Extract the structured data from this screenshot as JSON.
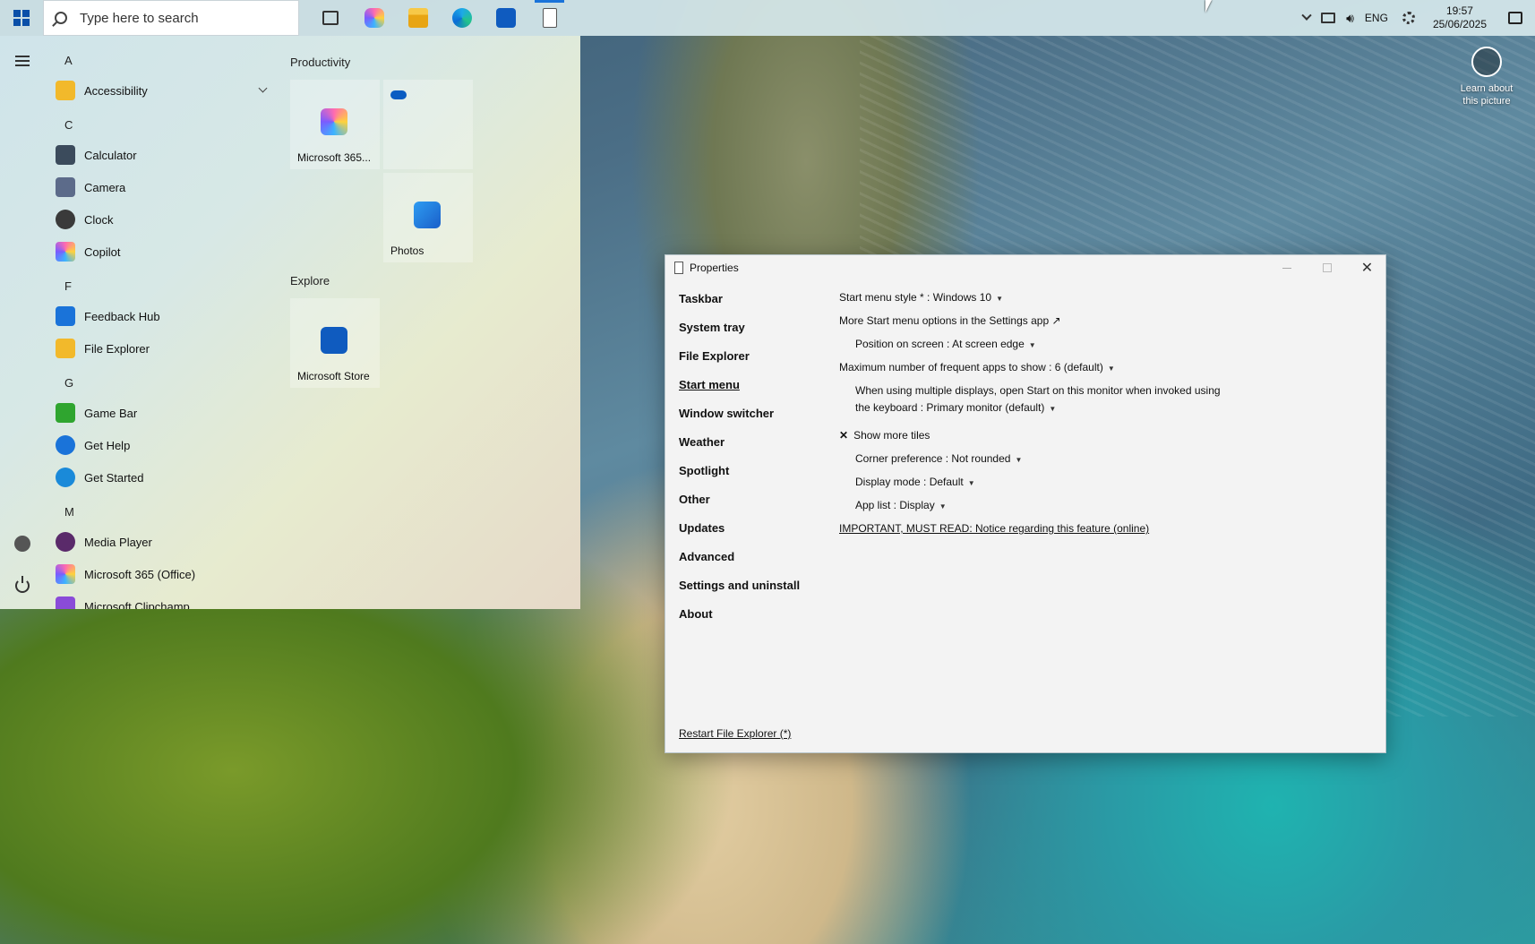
{
  "taskbar": {
    "search_placeholder": "Type here to search",
    "pinned": [
      "task-view",
      "copilot",
      "file-explorer",
      "edge",
      "microsoft-store",
      "properties"
    ],
    "tray": {
      "language": "ENG",
      "time": "19:57",
      "date": "25/06/2025"
    }
  },
  "start_menu": {
    "letters": {
      "a": "A",
      "c": "C",
      "f": "F",
      "g": "G",
      "m": "M"
    },
    "apps": [
      {
        "label": "Accessibility",
        "icon": "folder-icon",
        "color": "#f2b92b"
      },
      {
        "label": "Calculator",
        "icon": "calculator-icon",
        "color": "#3b4b5c"
      },
      {
        "label": "Camera",
        "icon": "camera-icon",
        "color": "#5c6b8a"
      },
      {
        "label": "Clock",
        "icon": "clock-icon",
        "color": "#3a3a3a"
      },
      {
        "label": "Copilot",
        "icon": "copilot-icon",
        "color": "#7a5cff"
      },
      {
        "label": "Feedback Hub",
        "icon": "feedback-hub-icon",
        "color": "#1a73d9"
      },
      {
        "label": "File Explorer",
        "icon": "file-explorer-icon",
        "color": "#f2b92b"
      },
      {
        "label": "Game Bar",
        "icon": "game-bar-icon",
        "color": "#2fa52f"
      },
      {
        "label": "Get Help",
        "icon": "get-help-icon",
        "color": "#1a73d9"
      },
      {
        "label": "Get Started",
        "icon": "get-started-icon",
        "color": "#1a8ad9"
      },
      {
        "label": "Media Player",
        "icon": "media-player-icon",
        "color": "#5a2a6a"
      },
      {
        "label": "Microsoft 365 (Office)",
        "icon": "microsoft-365-icon",
        "color": "#7a5cff"
      },
      {
        "label": "Microsoft Clipchamp",
        "icon": "clipchamp-icon",
        "color": "#8a4bd8"
      }
    ],
    "groups": {
      "productivity": "Productivity",
      "explore": "Explore"
    },
    "tiles": {
      "m365": "Microsoft 365...",
      "onedrive": "",
      "photos": "Photos",
      "store": "Microsoft Store"
    }
  },
  "properties": {
    "title": "Properties",
    "nav": [
      "Taskbar",
      "System tray",
      "File Explorer",
      "Start menu",
      "Window switcher",
      "Weather",
      "Spotlight",
      "Other",
      "Updates",
      "Advanced",
      "Settings and uninstall",
      "About"
    ],
    "active_nav": "Start menu",
    "options": {
      "style": "Start menu style * : Windows 10",
      "more_options": "More Start menu options in the Settings app ↗",
      "position": "Position on screen : At screen edge",
      "max_frequent": "Maximum number of frequent apps to show : 6 (default)",
      "multi_display_1": "When using multiple displays, open Start on this monitor when invoked using",
      "multi_display_2": "the keyboard : Primary monitor (default)",
      "show_more_tiles": "Show more tiles",
      "corner": "Corner preference : Not rounded",
      "display_mode": "Display mode : Default",
      "app_list": "App list : Display",
      "important": "IMPORTANT, MUST READ: Notice regarding this feature (online)"
    },
    "restart": "Restart File Explorer (*)"
  },
  "desktop": {
    "learn_1": "Learn about",
    "learn_2": "this picture"
  }
}
